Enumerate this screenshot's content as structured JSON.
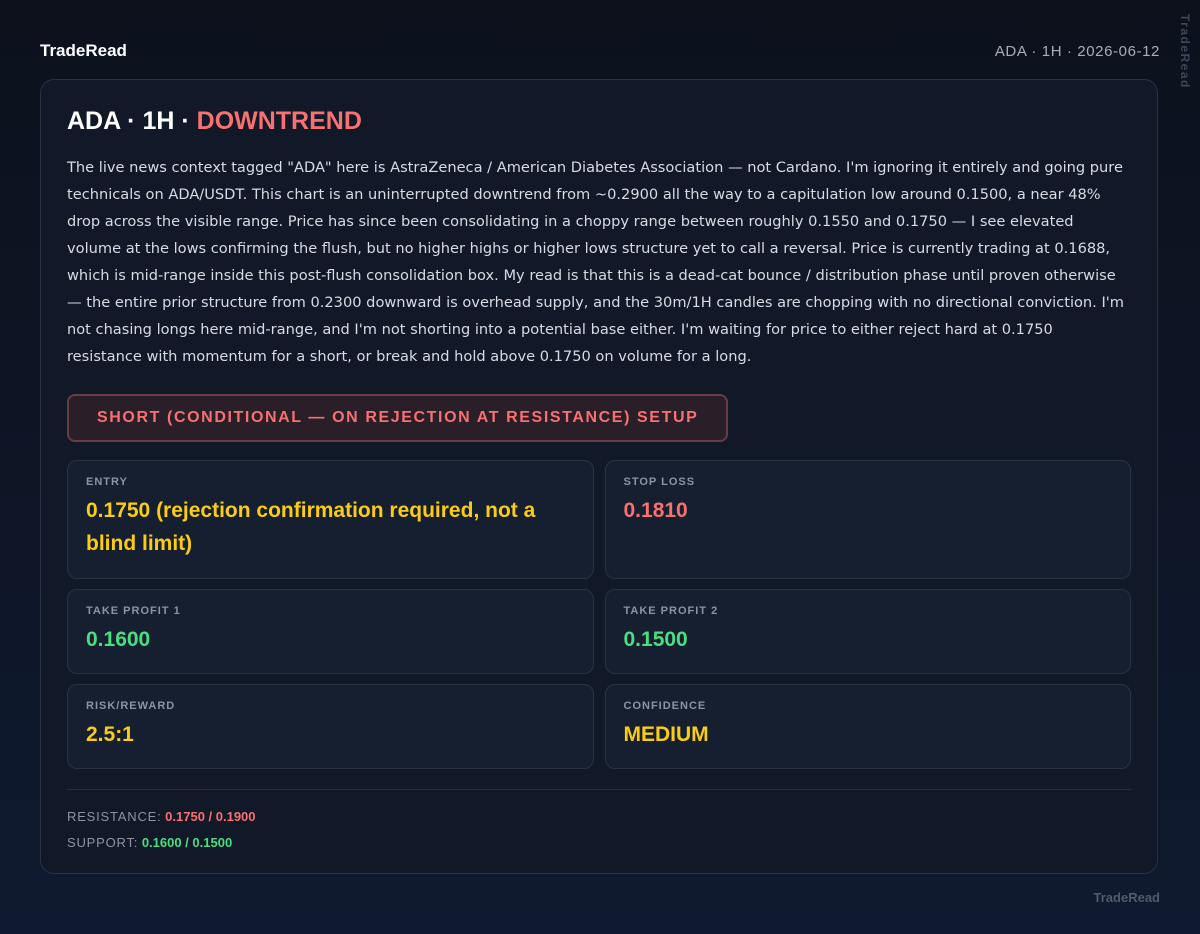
{
  "header": {
    "brand": "TradeRead",
    "meta": "ADA · 1H · 2026-06-12",
    "vertical_brand": "TradeRead"
  },
  "card": {
    "headline_prefix": "ADA · 1H · ",
    "trend": "DOWNTREND",
    "analysis": "The live news context tagged \"ADA\" here is AstraZeneca / American Diabetes Association — not Cardano. I'm ignoring it entirely and going pure technicals on ADA/USDT. This chart is an uninterrupted downtrend from ~0.2900 all the way to a capitulation low around 0.1500, a near 48% drop across the visible range. Price has since been consolidating in a choppy range between roughly 0.1550 and 0.1750 — I see elevated volume at the lows confirming the flush, but no higher highs or higher lows structure yet to call a reversal. Price is currently trading at 0.1688, which is mid-range inside this post-flush consolidation box. My read is that this is a dead-cat bounce / distribution phase until proven otherwise — the entire prior structure from 0.2300 downward is overhead supply, and the 30m/1H candles are chopping with no directional conviction. I'm not chasing longs here mid-range, and I'm not shorting into a potential base either. I'm waiting for price to either reject hard at 0.1750 resistance with momentum for a short, or break and hold above 0.1750 on volume for a long.",
    "setup": "SHORT (CONDITIONAL — ON REJECTION AT RESISTANCE) SETUP",
    "tiles": {
      "entry": {
        "label": "ENTRY",
        "value": "0.1750 (rejection confirmation required, not a blind limit)"
      },
      "stop_loss": {
        "label": "STOP LOSS",
        "value": "0.1810"
      },
      "tp1": {
        "label": "TAKE PROFIT 1",
        "value": "0.1600"
      },
      "tp2": {
        "label": "TAKE PROFIT 2",
        "value": "0.1500"
      },
      "rr": {
        "label": "RISK/REWARD",
        "value": "2.5:1"
      },
      "confidence": {
        "label": "CONFIDENCE",
        "value": "MEDIUM"
      }
    },
    "levels": {
      "resistance_label": "RESISTANCE:",
      "resistance_value": "0.1750 / 0.1900",
      "support_label": "SUPPORT:",
      "support_value": "0.1600 / 0.1500"
    }
  },
  "footer": {
    "brand": "TradeRead"
  },
  "colors": {
    "bearish": "#f87171",
    "bullish": "#4ade80",
    "neutral_value": "#facc15",
    "card_bg": "#111827"
  }
}
